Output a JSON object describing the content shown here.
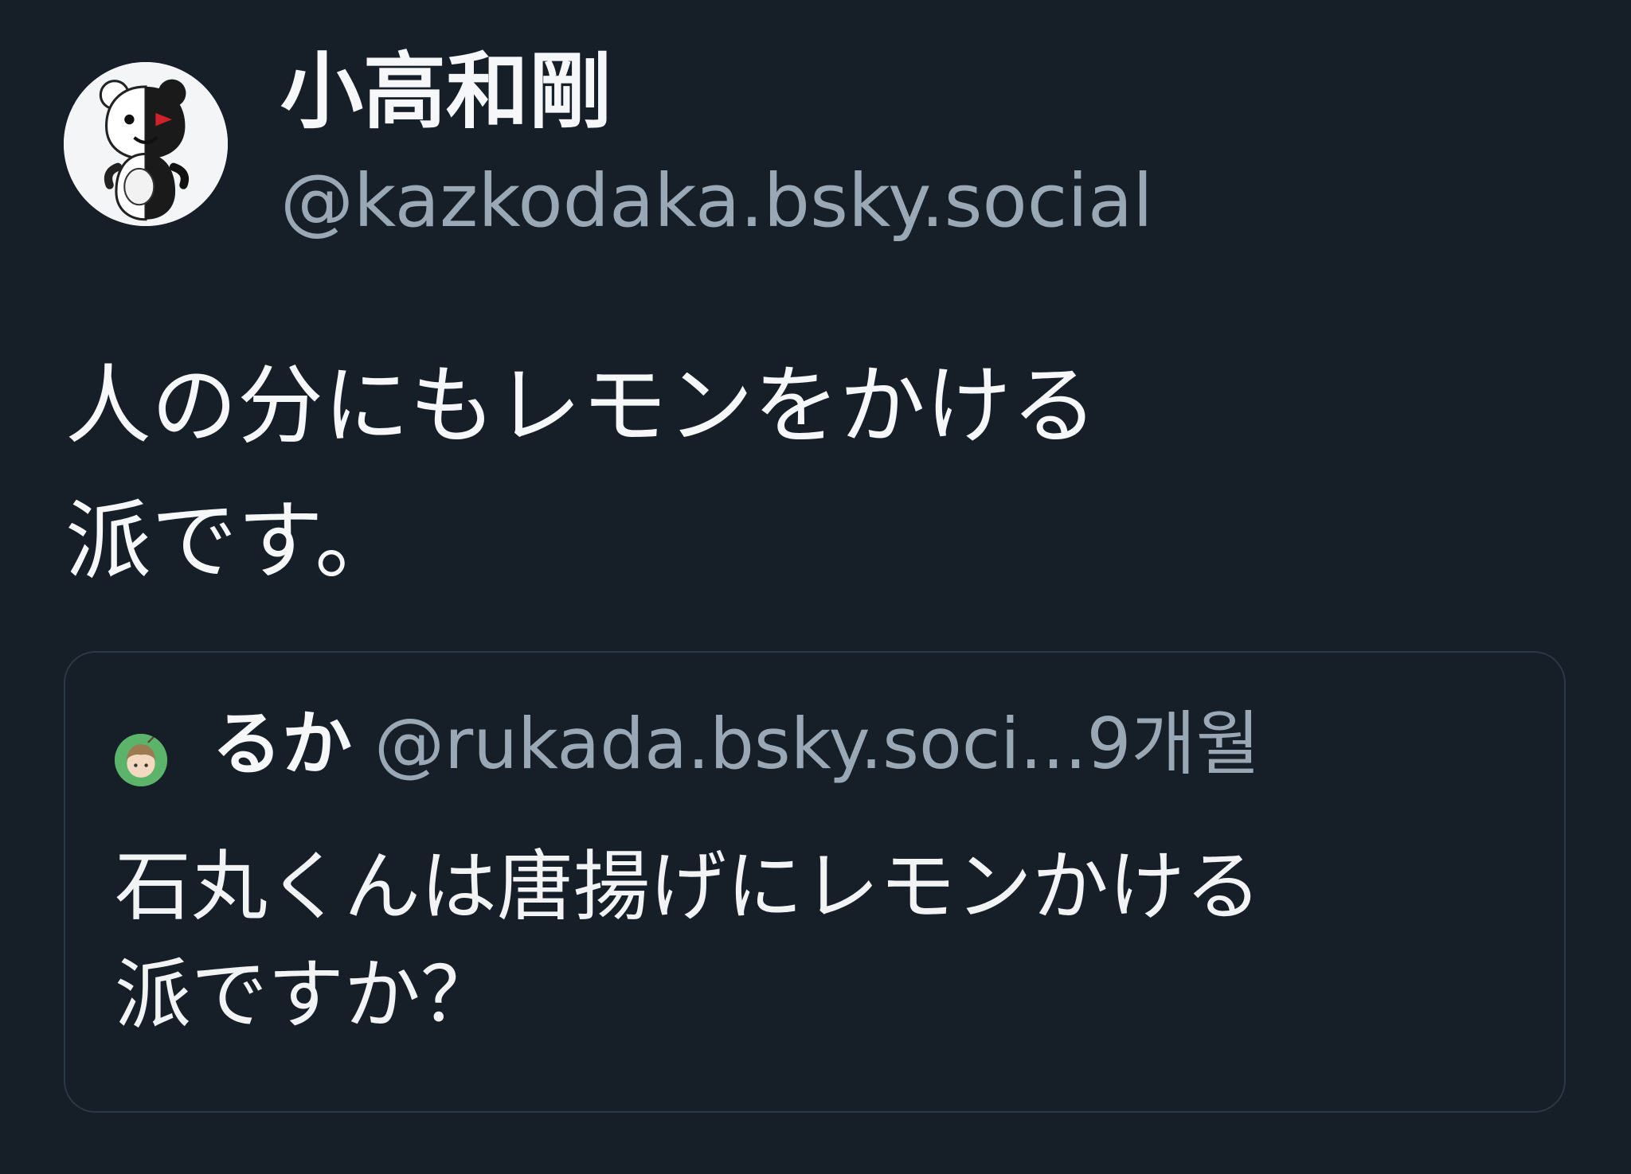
{
  "post": {
    "author": {
      "display_name": "小高和剛",
      "handle": "@kazkodaka.bsky.social",
      "avatar_icon": "monokuma-avatar-icon"
    },
    "text_lines": [
      "人の分にもレモンをかける",
      "派です。"
    ]
  },
  "quote": {
    "author": {
      "display_name": "るか",
      "handle": "@rukada.bsky.soci...",
      "avatar_icon": "user-avatar-icon"
    },
    "time_ago": "9개월",
    "text_lines": [
      "石丸くんは唐揚げにレモンかける",
      "派ですか？"
    ]
  },
  "colors": {
    "background": "#161e27",
    "primary_text": "#f5f7f9",
    "secondary_text": "#9aa8b6",
    "card_border": "#2c3845"
  }
}
